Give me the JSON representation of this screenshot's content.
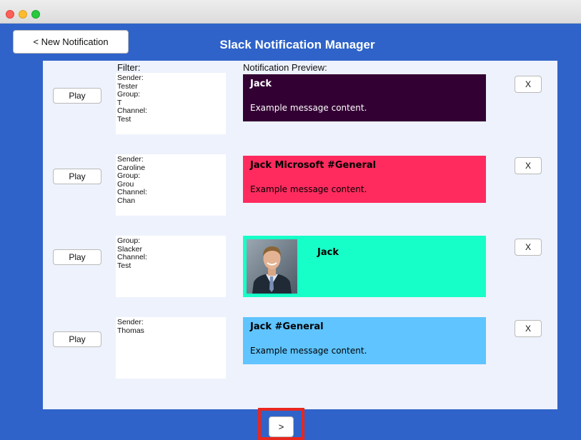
{
  "window": {
    "title": "Slack Notification Manager"
  },
  "toolbar": {
    "new_notification_label": "< New Notification"
  },
  "headers": {
    "filter": "Filter:",
    "preview": "Notification Preview:"
  },
  "rows": [
    {
      "play_label": "Play",
      "remove_label": "X",
      "filter_lines": [
        "Sender:",
        "Tester",
        "Group:",
        "T",
        "Channel:",
        "Test"
      ],
      "preview": {
        "title": "Jack",
        "message": "Example message content.",
        "background": "#330033",
        "text_color": "#ffffff",
        "has_avatar": false
      }
    },
    {
      "play_label": "Play",
      "remove_label": "X",
      "filter_lines": [
        "Sender:",
        "Caroline",
        "Group:",
        "Grou",
        "Channel:",
        "Chan"
      ],
      "preview": {
        "title": "Jack Microsoft #General",
        "message": "Example message content.",
        "background": "#ff2b5f",
        "text_color": "#000000",
        "has_avatar": false
      }
    },
    {
      "play_label": "Play",
      "remove_label": "X",
      "filter_lines": [
        "Group:",
        "Slacker",
        "Channel:",
        "Test"
      ],
      "preview": {
        "title": "Jack",
        "message": "",
        "background": "#17ffc8",
        "text_color": "#000000",
        "has_avatar": true
      }
    },
    {
      "play_label": "Play",
      "remove_label": "X",
      "filter_lines": [
        "Sender:",
        "Thomas"
      ],
      "preview": {
        "title": "Jack #General",
        "message": "Example message content.",
        "background": "#5fc4ff",
        "text_color": "#000000",
        "has_avatar": false
      }
    }
  ],
  "pagination": {
    "next_label": ">"
  },
  "colors": {
    "app_background": "#2f63c9",
    "panel_background": "#eef2fc",
    "highlight": "#e8271f"
  }
}
